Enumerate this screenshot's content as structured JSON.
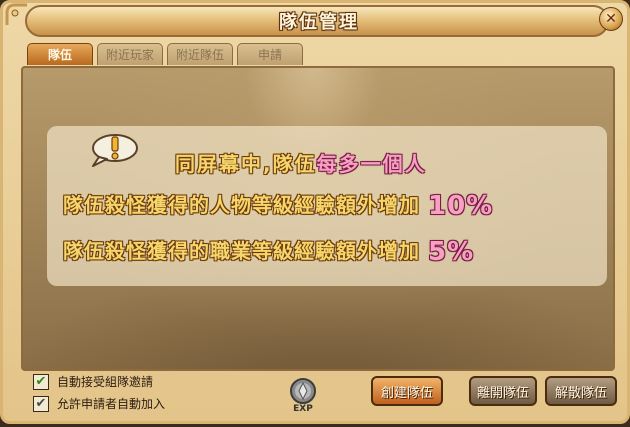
{
  "window": {
    "title": "隊伍管理",
    "close_label": "✕"
  },
  "tabs": [
    {
      "label": "隊伍",
      "active": true
    },
    {
      "label": "附近玩家",
      "active": false
    },
    {
      "label": "附近隊伍",
      "active": false
    },
    {
      "label": "申請",
      "active": false
    }
  ],
  "info": {
    "icon": "exclamation-bubble-icon",
    "line1_prefix": "同屏幕中,隊伍",
    "line1_highlight": "每多一個人",
    "line2_text": "隊伍殺怪獲得的人物等級經驗額外增加",
    "line2_value": "10%",
    "line3_text": "隊伍殺怪獲得的職業等級經驗額外增加",
    "line3_value": "5%"
  },
  "options": {
    "auto_accept_label": "自動接受組隊邀請",
    "auto_accept_checked": true,
    "auto_join_label": "允許申請者自動加入",
    "auto_join_checked": true
  },
  "exp_icon": {
    "label": "EXP"
  },
  "buttons": {
    "create": "創建隊伍",
    "leave": "離開隊伍",
    "disband": "解散隊伍"
  },
  "colors": {
    "gold_text": "#f6d56a",
    "pink_text": "#f7a0c2",
    "active_tab": "#e7a85b",
    "check_green": "#2c8a1c"
  }
}
